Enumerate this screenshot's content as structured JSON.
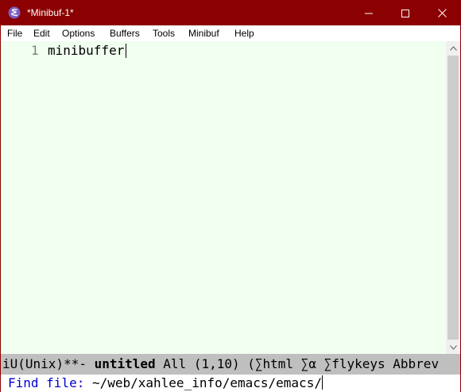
{
  "window": {
    "title": "*Minibuf-1*",
    "titlebar_color": "#8b0000"
  },
  "menu": {
    "items": [
      "File",
      "Edit",
      "Options",
      "Buffers",
      "Tools",
      "Minibuf",
      "Help"
    ]
  },
  "editor": {
    "background": "#f0fff0",
    "lines": [
      {
        "number": "1",
        "text": "minibuffer"
      }
    ]
  },
  "modeline": {
    "prefix": "iU(Unix)**- ",
    "buffer_name": "untitled",
    "position": " All (1,10) ",
    "modes": "(∑html ∑α ∑flykeys Abbrev"
  },
  "minibuffer": {
    "prompt": "Find file: ",
    "value": "~/web/xahlee_info/emacs/emacs/"
  },
  "icons": {
    "app": "emacs-icon",
    "minimize": "minimize-icon",
    "maximize": "maximize-icon",
    "close": "close-icon"
  }
}
